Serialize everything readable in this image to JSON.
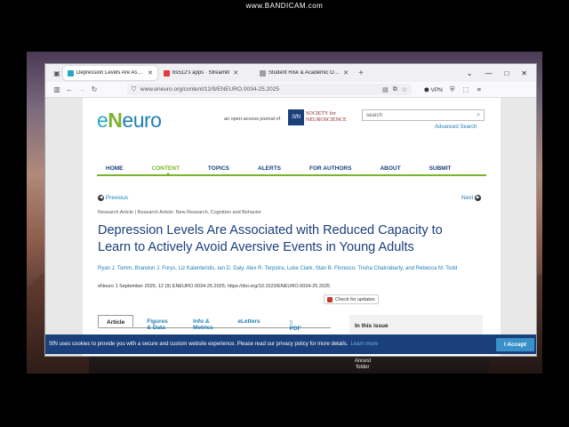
{
  "recorder": {
    "watermark": "www.BANDICAM.com"
  },
  "desktop": {
    "folder_label": "Ancest folder"
  },
  "browser": {
    "tabs": [
      {
        "label": "Depression Levels Are Associat",
        "active": true,
        "color": "#2aa6c4"
      },
      {
        "label": "bs512's apps · Streamlit",
        "active": false,
        "color": "#e53935"
      },
      {
        "label": "Student Risk & Academic Outc",
        "active": false,
        "color": "#9e9e9e"
      }
    ],
    "url": "www.eneuro.org/content/12/9/ENEURO.0034-25.2025",
    "vpn_label": "VPN"
  },
  "site": {
    "logo_e": "e",
    "logo_n": "N",
    "logo_rest": "euro",
    "open_access": "an open-access journal of",
    "sfn_mark": "SfN",
    "sfn_line1": "SOCIETY for",
    "sfn_line2": "NEUROSCIENCE",
    "search_placeholder": "search",
    "advanced_search": "Advanced Search",
    "nav": [
      "HOME",
      "CONTENT",
      "TOPICS",
      "ALERTS",
      "FOR AUTHORS",
      "ABOUT",
      "SUBMIT"
    ],
    "active_nav": "CONTENT"
  },
  "article": {
    "previous": "Previous",
    "next": "Next",
    "breadcrumb": "Research Article  |  Research Article: New Research, Cognition and Behavior",
    "title": "Depression Levels Are Associated with Reduced Capacity to Learn to Actively Avoid Aversive Events in Young Adults",
    "authors": "Ryan J. Tomm, Brandon J. Forys, Liz Kalenteridis, Ian D. Daly, Alex R. Terpstra, Luke Clark, Stan B. Floresco, Trisha Chakrabarty, and Rebecca M. Todd",
    "citation": "eNeuro 1 September 2025, 12 (9) ENEURO.0034-25.2025; https://doi.org/10.1523/ENEURO.0034-25.2025",
    "updates_label": "Check for updates",
    "tabs": [
      "Article",
      "Figures & Data",
      "Info & Metrics",
      "eLetters",
      "PDF"
    ],
    "in_this_issue": "In this issue"
  },
  "cookie": {
    "text": "SfN uses cookies to provide you with a secure and custom website experience. Please read our privacy policy for more details.",
    "learn_more": "Learn more",
    "accept": "I Accept"
  }
}
